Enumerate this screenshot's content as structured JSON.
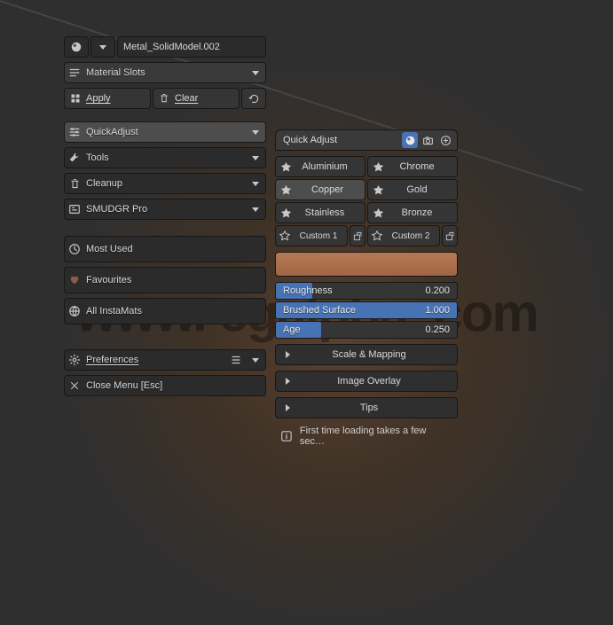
{
  "material_name": "Metal_SolidModel.002",
  "header": "Material Slots",
  "actions": {
    "apply": "Apply",
    "clear": "Clear"
  },
  "sections": {
    "quickadjust": "QuickAdjust",
    "tools": "Tools",
    "cleanup": "Cleanup",
    "smudgr": "SMUDGR Pro"
  },
  "filters": {
    "most_used": "Most Used",
    "favourites": "Favourites",
    "all_instamats": "All InstaMats"
  },
  "footer": {
    "preferences": "Preferences",
    "close": "Close Menu [Esc]"
  },
  "qa": {
    "title": "Quick Adjust",
    "presets": [
      [
        "Aluminium",
        "Chrome"
      ],
      [
        "Copper",
        "Gold"
      ],
      [
        "Stainless",
        "Bronze"
      ]
    ],
    "custom": [
      "Custom 1",
      "Custom 2"
    ],
    "sliders": [
      {
        "label": "Roughness",
        "value": "0.200",
        "fill": 20
      },
      {
        "label": "Brushed Surface",
        "value": "1.000",
        "fill": 100
      },
      {
        "label": "Age",
        "value": "0.250",
        "fill": 25
      }
    ],
    "expands": [
      "Scale & Mapping",
      "Image Overlay",
      "Tips"
    ],
    "info": "First time loading takes a few sec…"
  },
  "watermark": "www. cgalpha .com"
}
